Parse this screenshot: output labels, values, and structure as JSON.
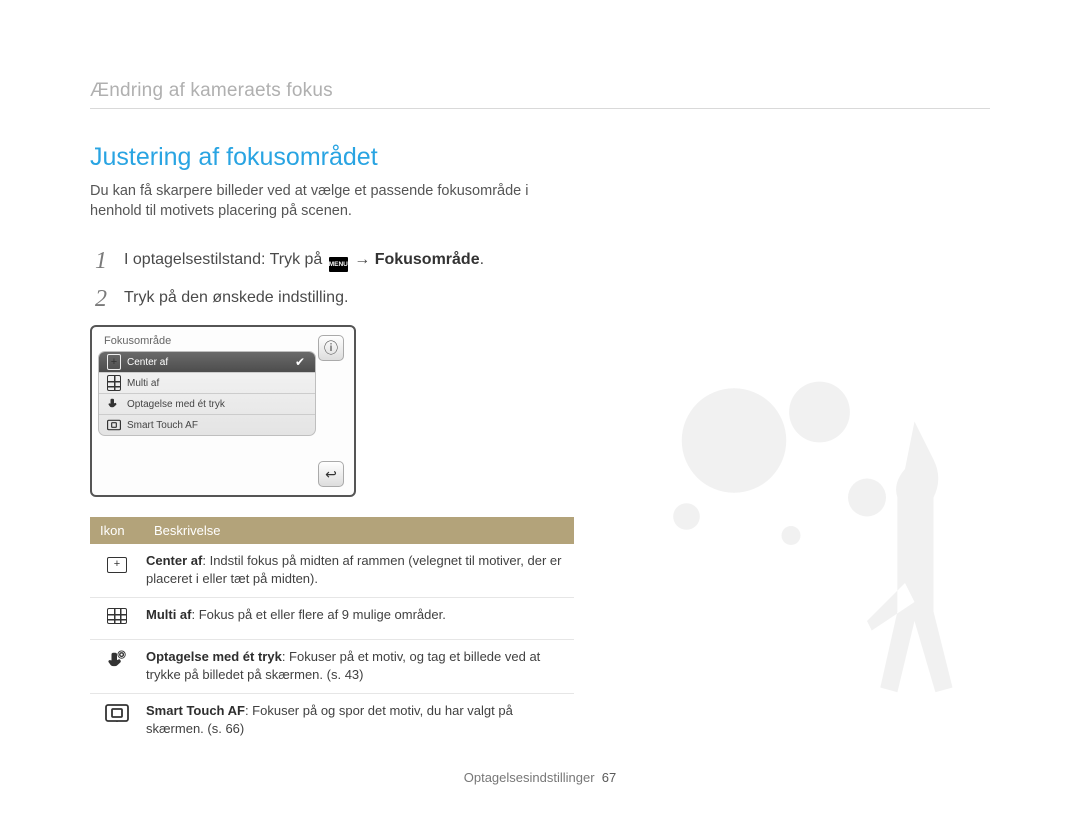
{
  "breadcrumb": "Ændring af kameraets fokus",
  "heading": "Justering af fokusområdet",
  "intro": "Du kan få skarpere billeder ved at vælge et passende fokusområde i henhold til motivets placering på scenen.",
  "steps": [
    {
      "num": "1",
      "prefix": "I optagelsestilstand: Tryk på ",
      "menu_label": "MENU",
      "arrow": " → ",
      "suffix_bold": "Fokusområde",
      "end": "."
    },
    {
      "num": "2",
      "text": "Tryk på den ønskede indstilling."
    }
  ],
  "camera_screen": {
    "title": "Fokusområde",
    "items": [
      {
        "label": "Center af",
        "selected": true,
        "icon": "center"
      },
      {
        "label": "Multi af",
        "selected": false,
        "icon": "multi"
      },
      {
        "label": "Optagelse med ét tryk",
        "selected": false,
        "icon": "touch"
      },
      {
        "label": "Smart Touch AF",
        "selected": false,
        "icon": "smart"
      }
    ],
    "info_icon": "ⓘ",
    "back_icon": "↩"
  },
  "table": {
    "headers": {
      "icon": "Ikon",
      "desc": "Beskrivelse"
    },
    "rows": [
      {
        "icon": "center",
        "term": "Center af",
        "desc": ": Indstil fokus på midten af rammen (velegnet til motiver, der er placeret i eller tæt på midten)."
      },
      {
        "icon": "multi",
        "term": "Multi af",
        "desc": ": Fokus på et eller flere af 9 mulige områder."
      },
      {
        "icon": "touch",
        "term": "Optagelse med ét tryk",
        "desc": ": Fokuser på et motiv, og tag et billede ved at trykke på billedet på skærmen. (s. 43)"
      },
      {
        "icon": "smart",
        "term": "Smart Touch AF",
        "desc": ": Fokuser på og spor det motiv, du har valgt på skærmen. (s. 66)"
      }
    ]
  },
  "footer": {
    "section": "Optagelsesindstillinger",
    "page": "67"
  }
}
